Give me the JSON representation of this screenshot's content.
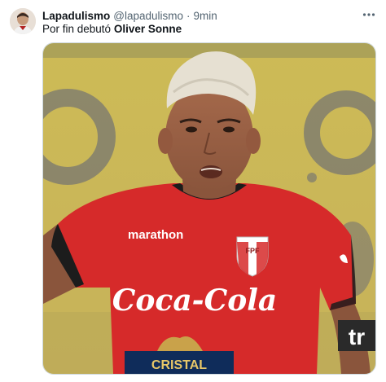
{
  "author": {
    "name": "Lapadulismo",
    "handle": "@lapadulismo",
    "separator": "·",
    "time": "9min"
  },
  "post": {
    "text_prefix": "Por fin debutó ",
    "text_bold": "Oliver Sonne"
  },
  "image": {
    "jersey_brand": "marathon",
    "sponsor": "Coca-Cola",
    "crest_text": "FPF",
    "bottom_sponsor": "CRISTAL",
    "watermark": "tr"
  },
  "colors": {
    "jersey_red": "#d62a2a",
    "background_yellow": "#d9c65a",
    "hair_blond": "#e6e0d2"
  },
  "icons": {
    "more": "more-horizontal-icon"
  }
}
